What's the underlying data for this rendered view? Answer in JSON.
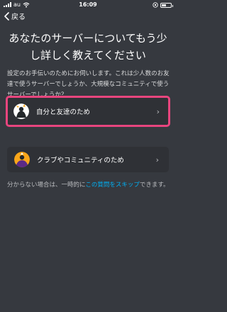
{
  "status_bar": {
    "carrier": "au",
    "time": "16:09"
  },
  "nav": {
    "back_label": "戻る"
  },
  "title": "あなたのサーバーについてもう少し詳しく教えてください",
  "description": "設定のお手伝いのためにお伺いします。これは少人数のお友達で使うサーバーでしょうか、大規模なコミュニティで使うサーバーでしょうか？",
  "options": [
    {
      "label": "自分と友達のため",
      "icon": "friends-icon",
      "selected": true
    },
    {
      "label": "クラブやコミュニティのため",
      "icon": "community-icon",
      "selected": false
    }
  ],
  "footer": {
    "prefix": "分からない場合は、一時的に",
    "link": "この質問をスキップ",
    "suffix": "できます。"
  },
  "colors": {
    "background": "#36393f",
    "card": "#2f3136",
    "highlight": "#e8457e",
    "link": "#00b0f4"
  }
}
